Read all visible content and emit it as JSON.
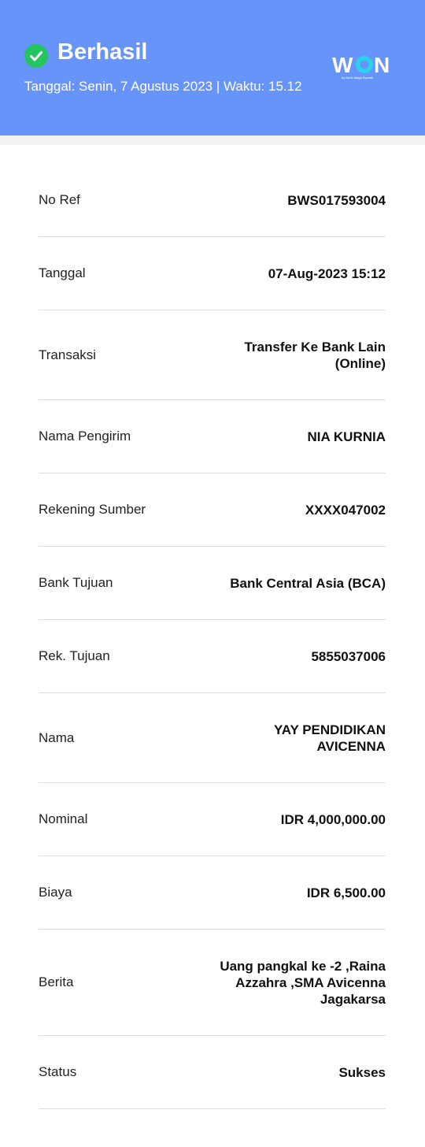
{
  "header": {
    "title": "Berhasil",
    "subtitle": "Tanggal: Senin, 7 Agustus 2023 | Waktu: 15.12",
    "logo_text": "WON",
    "logo_tagline": "by Bank Mega Syariah",
    "background_color": "#6694f8",
    "check_color": "#22c55e"
  },
  "details": [
    {
      "label": "No Ref",
      "value": "BWS017593004"
    },
    {
      "label": "Tanggal",
      "value": "07-Aug-2023 15:12"
    },
    {
      "label": "Transaksi",
      "value": "Transfer Ke Bank Lain (Online)"
    },
    {
      "label": "Nama Pengirim",
      "value": "NIA KURNIA"
    },
    {
      "label": "Rekening Sumber",
      "value": "XXXX047002"
    },
    {
      "label": "Bank Tujuan",
      "value": "Bank Central Asia (BCA)"
    },
    {
      "label": "Rek. Tujuan",
      "value": "5855037006"
    },
    {
      "label": "Nama",
      "value": "YAY PENDIDIKAN AVICENNA"
    },
    {
      "label": "Nominal",
      "value": "IDR 4,000,000.00"
    },
    {
      "label": "Biaya",
      "value": "IDR 6,500.00"
    },
    {
      "label": "Berita",
      "value": "Uang pangkal ke -2 ,Raina Azzahra ,SMA Avicenna Jagakarsa"
    },
    {
      "label": "Status",
      "value": "Sukses"
    }
  ]
}
